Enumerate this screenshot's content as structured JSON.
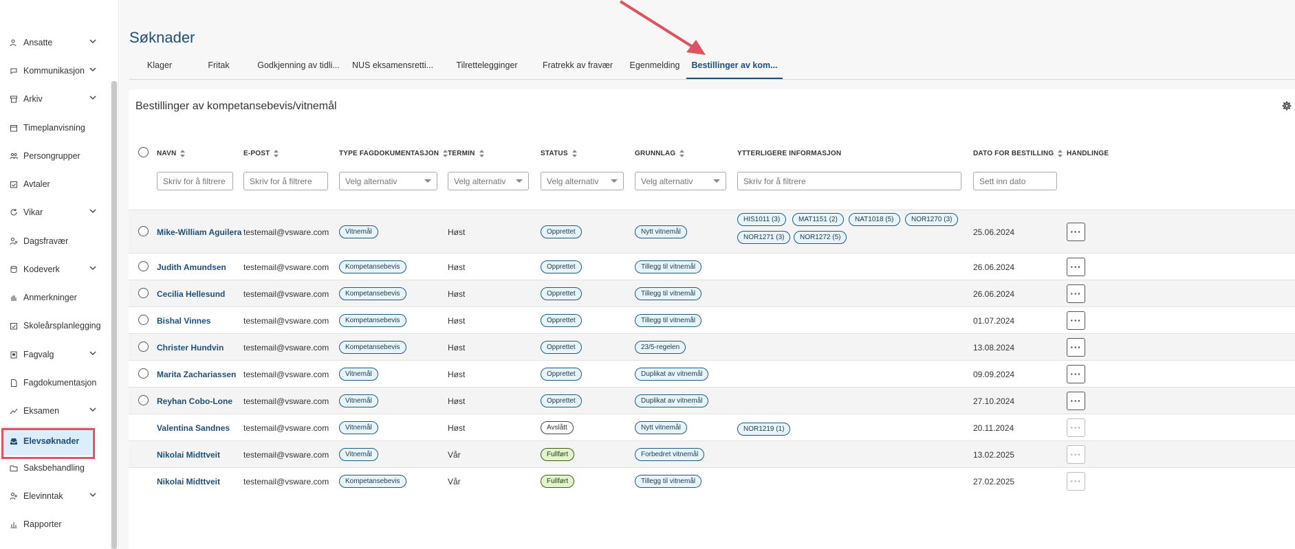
{
  "sidebar": {
    "items": [
      {
        "label": "Ansatte",
        "icon": "users-icon",
        "chevron": true
      },
      {
        "label": "Kommunikasjon",
        "icon": "chat-icon",
        "chevron": true
      },
      {
        "label": "Arkiv",
        "icon": "archive-icon",
        "chevron": true
      },
      {
        "label": "Timeplanvisning",
        "icon": "calendar-icon",
        "chevron": false
      },
      {
        "label": "Persongrupper",
        "icon": "group-icon",
        "chevron": false
      },
      {
        "label": "Avtaler",
        "icon": "calendar-check-icon",
        "chevron": false
      },
      {
        "label": "Vikar",
        "icon": "refresh-icon",
        "chevron": true
      },
      {
        "label": "Dagsfravær",
        "icon": "person-absence-icon",
        "chevron": false
      },
      {
        "label": "Kodeverk",
        "icon": "database-icon",
        "chevron": true
      },
      {
        "label": "Anmerkninger",
        "icon": "hand-icon",
        "chevron": false
      },
      {
        "label": "Skoleårsplanlegging",
        "icon": "calendar-plan-icon",
        "chevron": false
      },
      {
        "label": "Fagvalg",
        "icon": "clipboard-icon",
        "chevron": true
      },
      {
        "label": "Fagdokumentasjon",
        "icon": "document-icon",
        "chevron": false
      },
      {
        "label": "Eksamen",
        "icon": "exam-icon",
        "chevron": true
      },
      {
        "label": "Elevsøknader",
        "icon": "inbox-icon",
        "chevron": false,
        "active": true
      },
      {
        "label": "Saksbehandling",
        "icon": "folder-icon",
        "chevron": false
      },
      {
        "label": "Elevinntak",
        "icon": "intake-icon",
        "chevron": true
      },
      {
        "label": "Rapporter",
        "icon": "chart-icon",
        "chevron": false
      }
    ]
  },
  "page": {
    "title": "Søknader"
  },
  "tabs": [
    "Klager",
    "Fritak",
    "Godkjenning av tidli...",
    "NUS eksamensretti...",
    "Tilrettelegginger",
    "Fratrekk av fravær",
    "Egenmelding",
    "Bestillinger av kom..."
  ],
  "card": {
    "title": "Bestillinger av kompetansebevis/vitnemål"
  },
  "columns": {
    "navn": "NAVN",
    "epost": "E-POST",
    "type": "TYPE FAGDOKUMENTASJON",
    "termin": "TERMIN",
    "status": "STATUS",
    "grunnlag": "GRUNNLAG",
    "info": "YTTERLIGERE INFORMASJON",
    "dato": "DATO FOR BESTILLING",
    "handlinger": "HANDLINGE"
  },
  "filters": {
    "text_placeholder": "Skriv for å filtrere",
    "select_placeholder": "Velg alternativ",
    "date_placeholder": "Sett inn dato"
  },
  "rows": [
    {
      "name": "Mike-William Aguilera",
      "email": "testemail@vsware.com",
      "type": "Vitnemål",
      "termin": "Høst",
      "status": "Opprettet",
      "grunnlag": "Nytt vitnemål",
      "info": [
        "HIS1011 (3)",
        "MAT1151 (2)",
        "NAT1018 (5)",
        "NOR1270 (3)",
        "NOR1271 (3)",
        "NOR1272 (5)"
      ],
      "dato": "25.06.2024"
    },
    {
      "name": "Judith Amundsen",
      "email": "testemail@vsware.com",
      "type": "Kompetansebevis",
      "termin": "Høst",
      "status": "Opprettet",
      "grunnlag": "Tillegg til vitnemål",
      "info": [],
      "dato": "26.06.2024"
    },
    {
      "name": "Cecilia Hellesund",
      "email": "testemail@vsware.com",
      "type": "Kompetansebevis",
      "termin": "Høst",
      "status": "Opprettet",
      "grunnlag": "Tillegg til vitnemål",
      "info": [],
      "dato": "26.06.2024"
    },
    {
      "name": "Bishal Vinnes",
      "email": "testemail@vsware.com",
      "type": "Kompetansebevis",
      "termin": "Høst",
      "status": "Opprettet",
      "grunnlag": "Tillegg til vitnemål",
      "info": [],
      "dato": "01.07.2024"
    },
    {
      "name": "Christer Hundvin",
      "email": "testemail@vsware.com",
      "type": "Kompetansebevis",
      "termin": "Høst",
      "status": "Opprettet",
      "grunnlag": "23/5-regelen",
      "info": [],
      "dato": "13.08.2024"
    },
    {
      "name": "Marita Zachariassen",
      "email": "testemail@vsware.com",
      "type": "Vitnemål",
      "termin": "Høst",
      "status": "Opprettet",
      "grunnlag": "Duplikat av vitnemål",
      "info": [],
      "dato": "09.09.2024"
    },
    {
      "name": "Reyhan Cobo-Lone",
      "email": "testemail@vsware.com",
      "type": "Vitnemål",
      "termin": "Høst",
      "status": "Opprettet",
      "grunnlag": "Duplikat av vitnemål",
      "info": [],
      "dato": "27.10.2024"
    },
    {
      "name": "Valentina Sandnes",
      "email": "testemail@vsware.com",
      "type": "Vitnemål",
      "termin": "Høst",
      "status": "Avslått",
      "grunnlag": "Nytt vitnemål",
      "info": [
        "NOR1219 (1)"
      ],
      "dato": "20.11.2024"
    },
    {
      "name": "Nikolai Midttveit",
      "email": "testemail@vsware.com",
      "type": "Vitnemål",
      "termin": "Vår",
      "status": "Fullført",
      "grunnlag": "Forbedret vitnemål",
      "info": [],
      "dato": "13.02.2025"
    },
    {
      "name": "Nikolai Midttveit",
      "email": "testemail@vsware.com",
      "type": "Kompetansebevis",
      "termin": "Vår",
      "status": "Fullført",
      "grunnlag": "Tillegg til vitnemål",
      "info": [],
      "dato": "27.02.2025"
    }
  ],
  "colors": {
    "accent": "#1f4e79",
    "highlight": "#e05260",
    "active_bg": "#dcedfb"
  }
}
